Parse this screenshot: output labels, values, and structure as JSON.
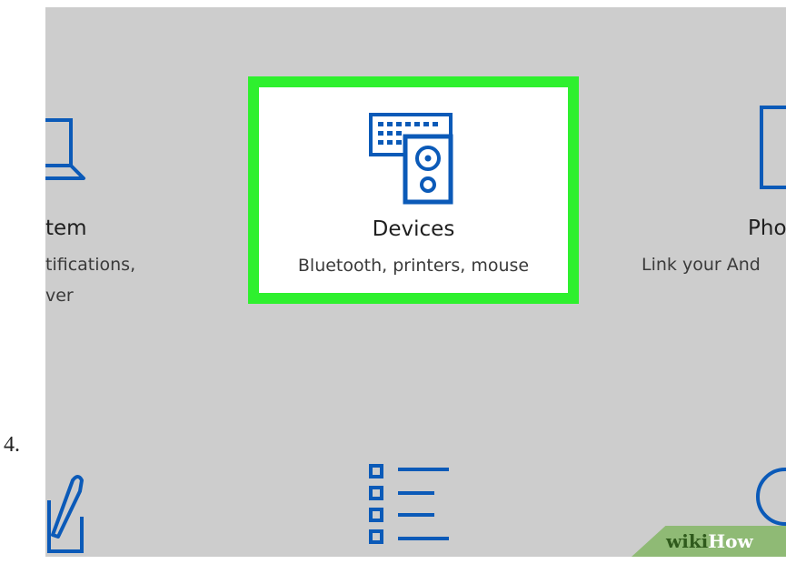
{
  "step": {
    "number": "4."
  },
  "tiles": {
    "system": {
      "title": "tem",
      "desc_line1": "tifications,",
      "desc_line2": "ver",
      "icon": "laptop-icon"
    },
    "devices": {
      "title": "Devices",
      "desc": "Bluetooth, printers, mouse",
      "icon": "devices-icon"
    },
    "phone": {
      "title": "Pho",
      "desc": "Link your And",
      "icon": "phone-icon"
    }
  },
  "bottom_row_icons": [
    "pen-tablet-icon",
    "apps-list-icon",
    "person-icon"
  ],
  "highlight": {
    "color": "#2ef02e"
  },
  "accent_color": "#0b5ab8",
  "watermark": {
    "wiki": "wiki",
    "how": "How"
  }
}
